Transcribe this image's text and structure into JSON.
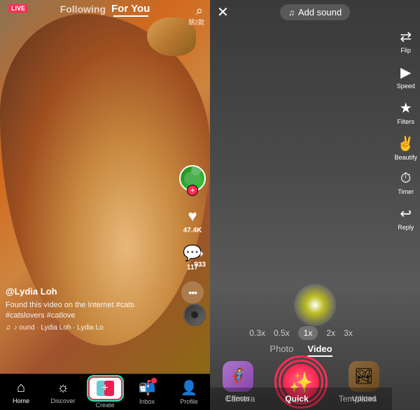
{
  "left": {
    "live_badge": "LIVE",
    "nav_following": "Following",
    "nav_foryou": "For You",
    "post_count": "朋2款",
    "like_count": "47.4K",
    "comment_count": "117",
    "share_count": "933",
    "username": "@Lydia Loh",
    "caption": "Found this video on the Internet #cats #catslovers #catlove",
    "music_text": "♪ ound · Lydia Loh · Lydia Lo",
    "bottom_nav": {
      "home": "Home",
      "discover": "Discover",
      "create": "Create",
      "inbox": "Inbox",
      "profile": "Profile"
    }
  },
  "right": {
    "close": "✕",
    "add_sound": "Add sound",
    "flip_label": "Flip",
    "speed_label": "Speed",
    "filters_label": "Filters",
    "beautify_label": "Beautify",
    "timer_label": "Timer",
    "reply_label": "Reply",
    "speeds": [
      "0.3x",
      "0.5x",
      "1x",
      "2x",
      "3x"
    ],
    "active_speed": "1x",
    "photo_tab": "Photo",
    "video_tab": "Video",
    "effects_label": "Effects",
    "upload_label": "Upload",
    "camera_tab": "Camera",
    "quick_tab": "Quick",
    "templates_tab": "Templates"
  }
}
